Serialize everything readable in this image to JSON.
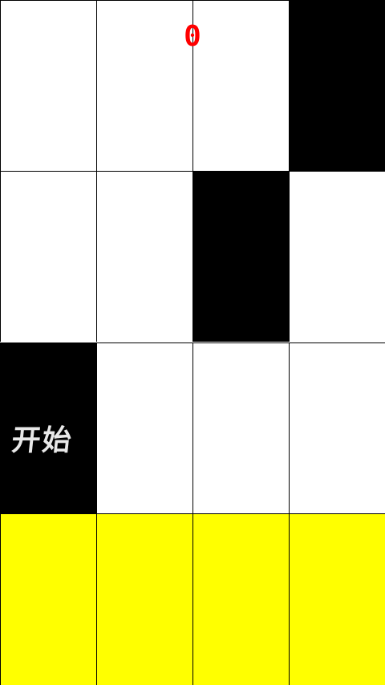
{
  "score": "0",
  "start_label": "开始",
  "colors": {
    "black_tile": "#000000",
    "white_tile": "#ffffff",
    "finish_row": "#ffff00",
    "score": "#ff0000"
  },
  "grid": [
    [
      "white",
      "white",
      "white",
      "black"
    ],
    [
      "white",
      "white",
      "black",
      "white"
    ],
    [
      "black",
      "white",
      "white",
      "white"
    ],
    [
      "yellow",
      "yellow",
      "yellow",
      "yellow"
    ]
  ]
}
